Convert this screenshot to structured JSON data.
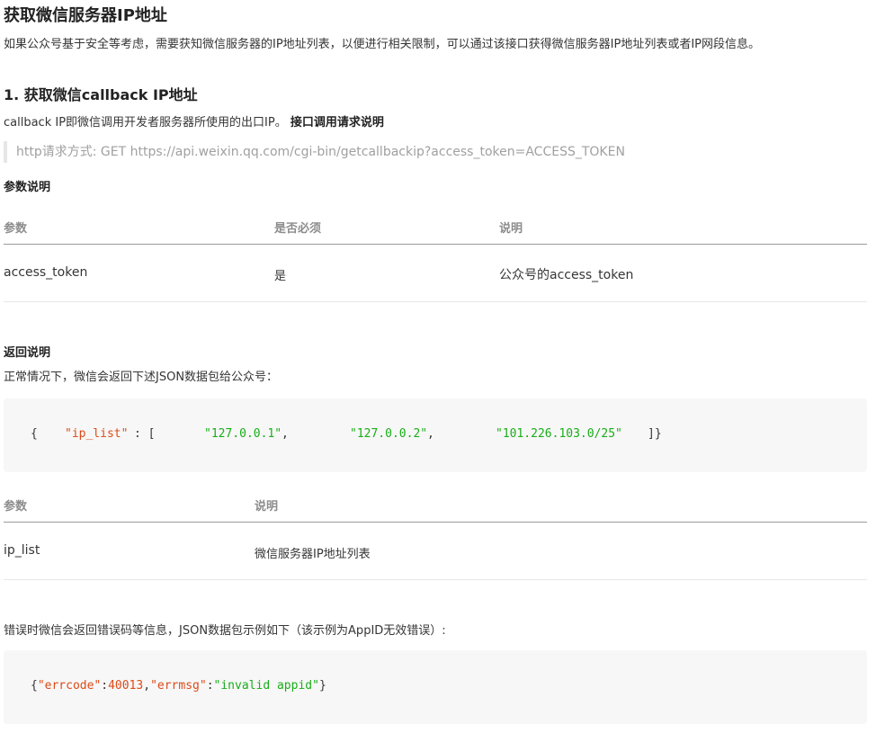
{
  "title": "获取微信服务器IP地址",
  "intro": "如果公众号基于安全等考虑，需要获知微信服务器的IP地址列表，以便进行相关限制，可以通过该接口获得微信服务器IP地址列表或者IP网段信息。",
  "section1": {
    "heading": "1. 获取微信callback IP地址",
    "desc": "callback IP即微信调用开发者服务器所使用的出口IP。",
    "desc_bold": "接口调用请求说明",
    "request": "http请求方式: GET https://api.weixin.qq.com/cgi-bin/getcallbackip?access_token=ACCESS_TOKEN",
    "params_heading": "参数说明",
    "params_table": {
      "headers": [
        "参数",
        "是否必须",
        "说明"
      ],
      "rows": [
        [
          "access_token",
          "是",
          "公众号的access_token"
        ]
      ]
    },
    "return_heading": "返回说明",
    "return_desc": "正常情况下，微信会返回下述JSON数据包给公众号：",
    "return_code": {
      "open": "{",
      "key": "\"ip_list\"",
      "colon": ": [",
      "ips": [
        "\"127.0.0.1\"",
        "\"127.0.0.2\"",
        "\"101.226.103.0/25\""
      ],
      "close": "]}",
      "comma": ","
    },
    "return_table": {
      "headers": [
        "参数",
        "说明"
      ],
      "rows": [
        [
          "ip_list",
          "微信服务器IP地址列表"
        ]
      ]
    },
    "error_desc": "错误时微信会返回错误码等信息，JSON数据包示例如下（该示例为AppID无效错误）:",
    "error_code": {
      "open": "{",
      "k1": "\"errcode\"",
      "c1": ":",
      "v1": "40013",
      "sep": ",",
      "k2": "\"errmsg\"",
      "c2": ":",
      "v2": "\"invalid appid\"",
      "close": "}"
    }
  }
}
